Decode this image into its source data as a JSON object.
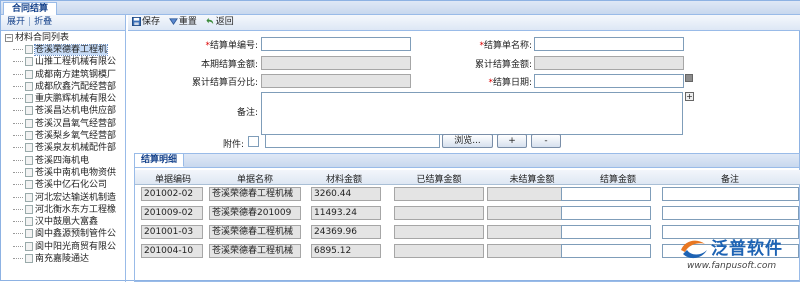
{
  "tab": {
    "title": "合同结算"
  },
  "left_toolbar": {
    "expand": "展开",
    "collapse": "折叠"
  },
  "tree": {
    "root": "材料合同列表",
    "items": [
      "苍溪荣德春工程机",
      "山推工程机械有限公",
      "成都南方建筑钢模厂",
      "成都欣鑫汽配经营部",
      "重庆鹏辉机械有限公",
      "苍溪昌达机电供应部",
      "苍溪汉昌氧气经营部",
      "苍溪梨乡氧气经营部",
      "苍溪泉友机械配件部",
      "苍溪四海机电",
      "苍溪中南机电物资供",
      "苍溪中亿石化公司",
      "河北宏达输送机制造",
      "河北衡水东方工程橡",
      "汉中鼓凰大富鑫",
      "阆中鑫源预制管件公",
      "阆中阳光商贸有限公",
      "南充嘉陵通达"
    ],
    "selected_index": 0
  },
  "toolbar": {
    "save": "保存",
    "reset": "重置",
    "back": "返回"
  },
  "form": {
    "settle_no_label": "结算单编号:",
    "settle_name_label": "结算单名称:",
    "period_amount_label": "本期结算金额:",
    "total_amount_label": "累计结算金额:",
    "total_percent_label": "累计结算百分比:",
    "settle_date_label": "结算日期:",
    "remark_label": "备注:",
    "attach_label": "附件:",
    "browse_label": "浏览...",
    "add_label": "+",
    "remove_label": "-"
  },
  "grid": {
    "title": "结算明细",
    "headers": [
      "单据编码",
      "单据名称",
      "材料金额",
      "已结算金额",
      "未结算金额",
      "结算金额",
      "备注"
    ],
    "rows": [
      {
        "code": "201002-02",
        "name": "苍溪荣德春工程机械",
        "amount": "3260.44"
      },
      {
        "code": "201009-02",
        "name": "苍溪荣德春201009",
        "amount": "11493.24"
      },
      {
        "code": "201001-03",
        "name": "苍溪荣德春工程机械",
        "amount": "24369.96"
      },
      {
        "code": "201004-10",
        "name": "苍溪荣德春工程机械",
        "amount": "6895.12"
      }
    ]
  },
  "watermark": {
    "brand": "泛普软件",
    "url": "www.fanpusoft.com"
  },
  "colors": {
    "accent": "#15428b",
    "border": "#99bbe8",
    "brand": "#1d63b4"
  }
}
